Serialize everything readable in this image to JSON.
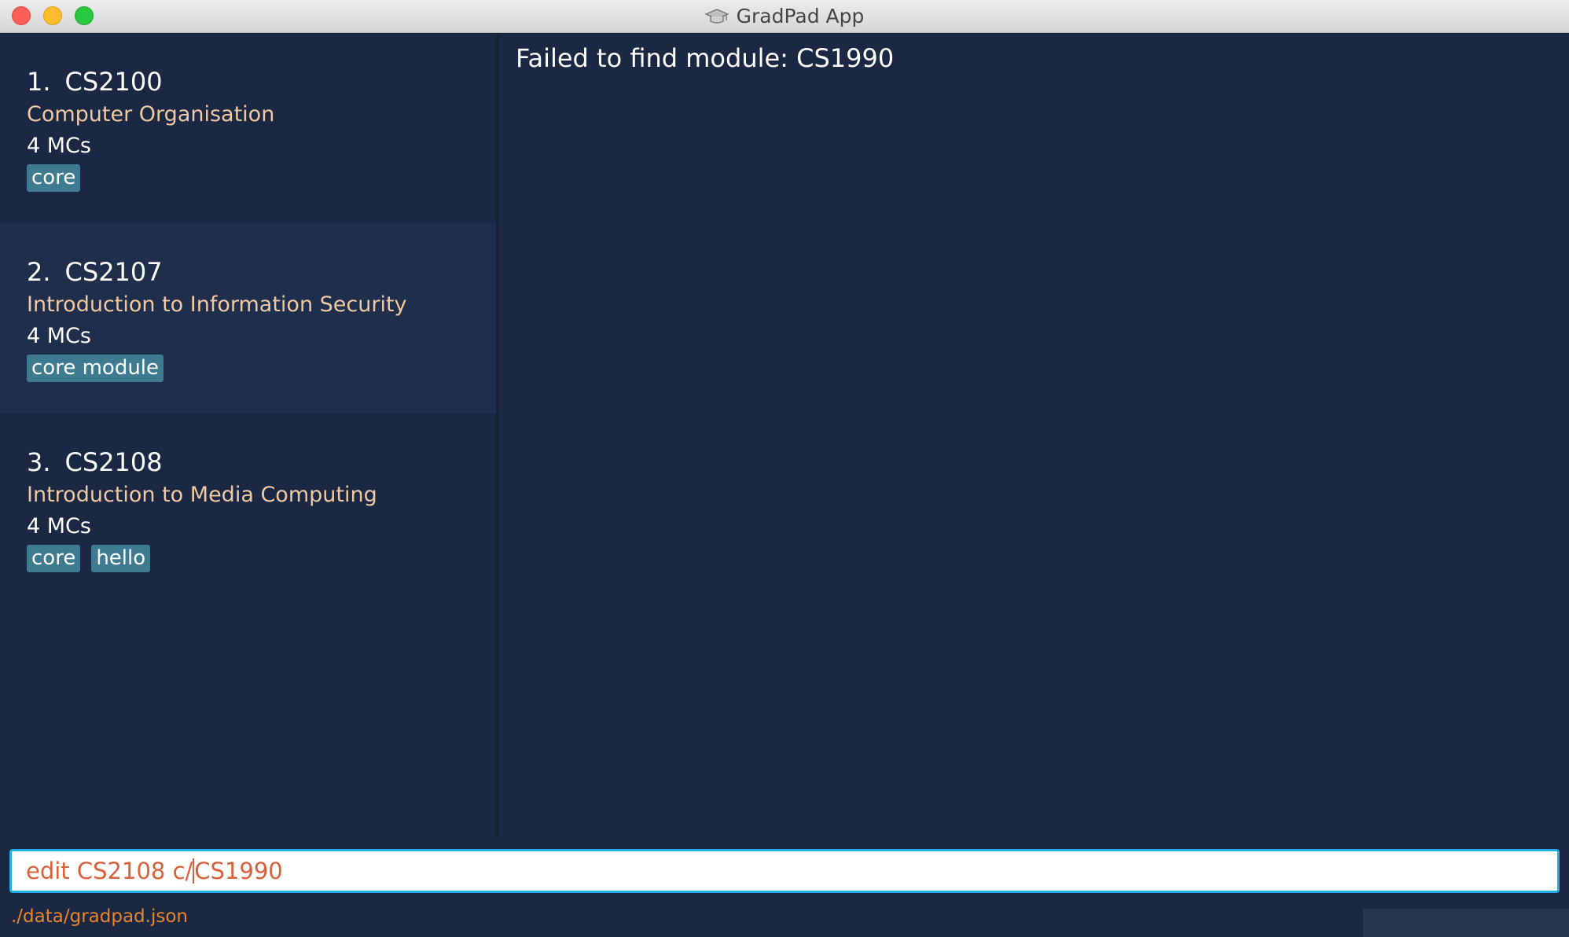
{
  "window": {
    "title": "GradPad App",
    "icon": "graduation-cap-icon"
  },
  "modules": [
    {
      "index": "1.",
      "code": "CS2100",
      "name": "Computer Organisation",
      "mcs": "4 MCs",
      "tags": [
        "core"
      ],
      "selected": false
    },
    {
      "index": "2.",
      "code": "CS2107",
      "name": "Introduction to Information Security",
      "mcs": "4 MCs",
      "tags": [
        "core module"
      ],
      "selected": true
    },
    {
      "index": "3.",
      "code": "CS2108",
      "name": "Introduction to Media Computing",
      "mcs": "4 MCs",
      "tags": [
        "core",
        "hello"
      ],
      "selected": false
    }
  ],
  "result": {
    "message": "Failed to find module: CS1990"
  },
  "command": {
    "text_before_caret": "edit CS2108 c/",
    "text_after_caret": "CS1990"
  },
  "status": {
    "file_path": "./data/gradpad.json"
  },
  "colors": {
    "background": "#1a2843",
    "selected_card": "#1f2e4a",
    "module_name": "#f0c9a4",
    "tag": "#3e7b91",
    "command_error_text": "#d9623b",
    "command_border": "#21b0e6",
    "status_path": "#e8852b"
  }
}
